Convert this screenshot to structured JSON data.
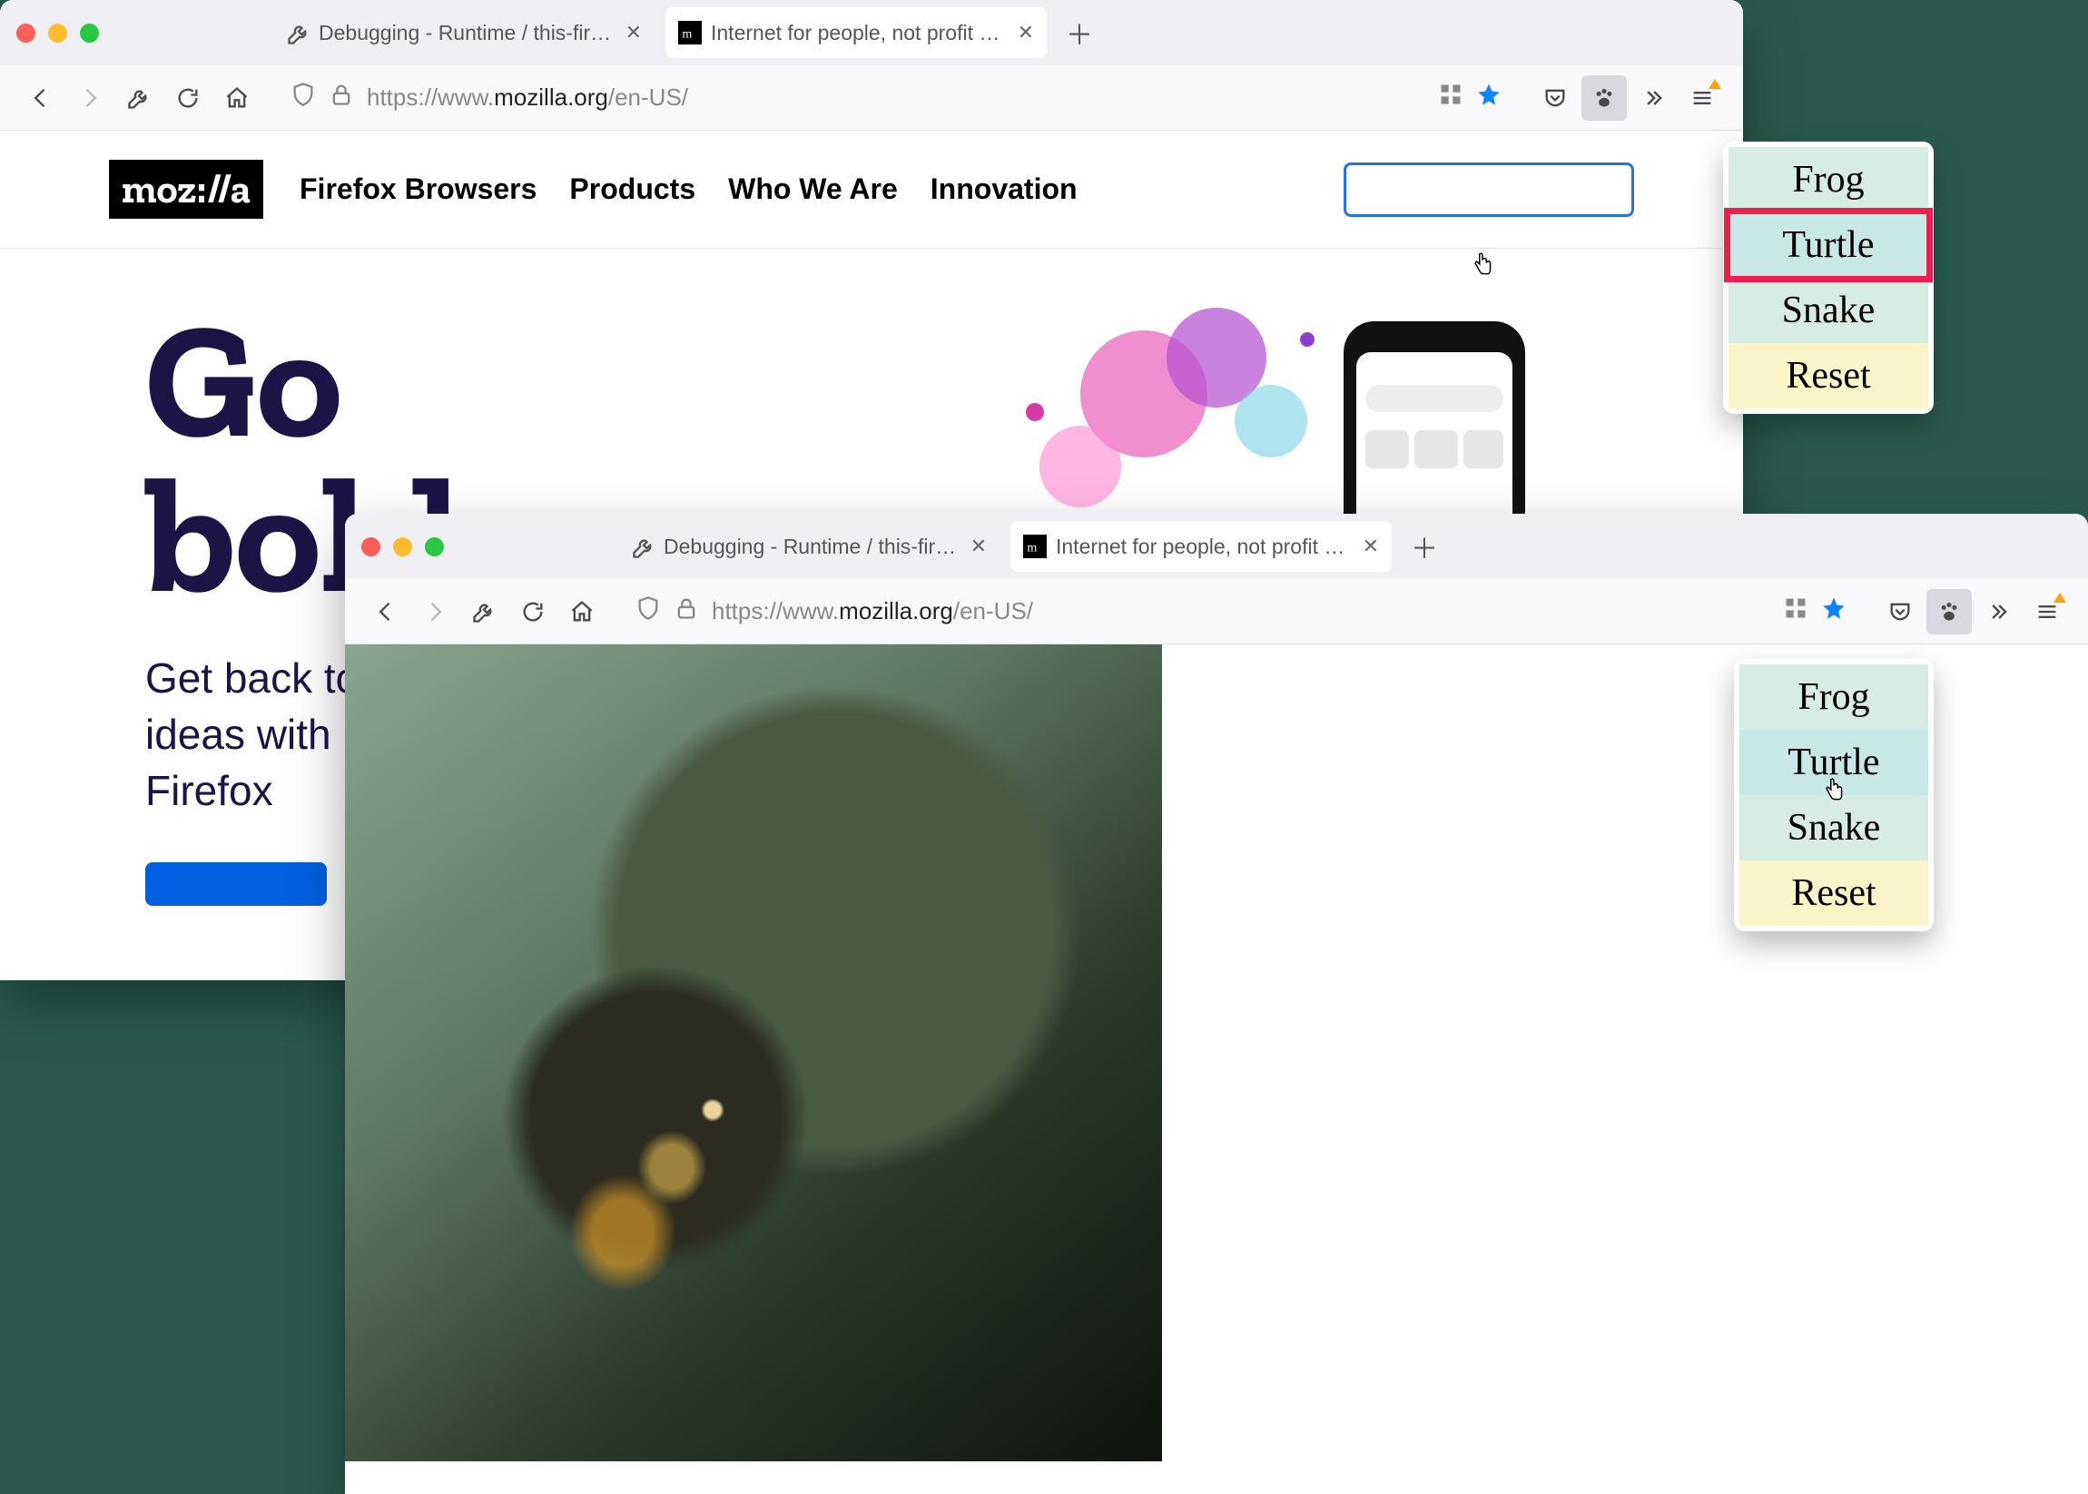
{
  "windows": {
    "back": {
      "tabs": [
        {
          "label": "Debugging - Runtime / this-firefox",
          "active": false
        },
        {
          "label": "Internet for people, not profit — Mozilla",
          "active": true
        }
      ],
      "url_prefix": "https://www.",
      "url_host": "mozilla.org",
      "url_path": "/en-US/"
    },
    "front": {
      "tabs": [
        {
          "label": "Debugging - Runtime / this-firefox",
          "active": false
        },
        {
          "label": "Internet for people, not profit — Mozilla",
          "active": true
        }
      ],
      "url_prefix": "https://www.",
      "url_host": "mozilla.org",
      "url_path": "/en-US/"
    }
  },
  "mozilla_page": {
    "logo_text": "moz://a",
    "nav": [
      "Firefox Browsers",
      "Products",
      "Who We Are",
      "Innovation"
    ],
    "hero_line1": "Go",
    "hero_line2": "bold",
    "subhead_line1": "Get back to your",
    "subhead_line2": "ideas with",
    "subhead_line3": "Firefox"
  },
  "popup_back": {
    "items": [
      {
        "label": "Frog",
        "tone": "green"
      },
      {
        "label": "Turtle",
        "tone": "teal",
        "highlighted": true
      },
      {
        "label": "Snake",
        "tone": "green"
      },
      {
        "label": "Reset",
        "tone": "yellow"
      }
    ]
  },
  "popup_front": {
    "items": [
      {
        "label": "Frog",
        "tone": "green"
      },
      {
        "label": "Turtle",
        "tone": "teal"
      },
      {
        "label": "Snake",
        "tone": "green"
      },
      {
        "label": "Reset",
        "tone": "yellow"
      }
    ]
  }
}
